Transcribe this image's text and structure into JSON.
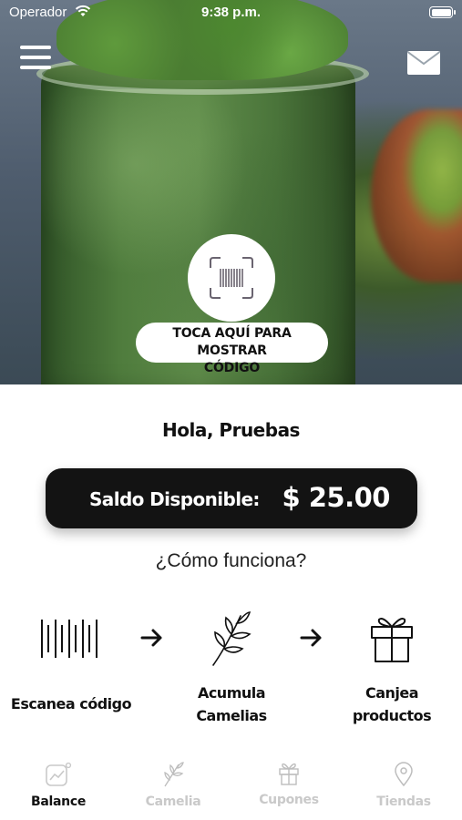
{
  "status_bar": {
    "carrier": "Operador",
    "time": "9:38 p.m."
  },
  "hero": {
    "scan_prompt_line1": "TOCA AQUÍ PARA MOSTRAR",
    "scan_prompt_line2": "CÓDIGO"
  },
  "greeting": "Hola, Pruebas",
  "balance": {
    "label": "Saldo Disponible:",
    "amount": "$ 25.00"
  },
  "how_it_works": {
    "title": "¿Cómo funciona?",
    "steps": [
      {
        "line1": "Escanea código",
        "line2": "",
        "icon": "barcode-icon"
      },
      {
        "line1": "Acumula",
        "line2": "Camelias",
        "icon": "leaf-branch-icon"
      },
      {
        "line1": "Canjea",
        "line2": "productos",
        "icon": "gift-icon"
      }
    ]
  },
  "tabs": [
    {
      "label": "Balance",
      "icon": "chart-icon",
      "active": true
    },
    {
      "label": "Camelia",
      "icon": "leaf-icon",
      "active": false
    },
    {
      "label": "Cupones",
      "icon": "gift-icon",
      "active": false
    },
    {
      "label": "Tiendas",
      "icon": "location-pin-icon",
      "active": false
    }
  ],
  "colors": {
    "card_background": "#131313",
    "inactive_tab": "#c9c9c9"
  }
}
